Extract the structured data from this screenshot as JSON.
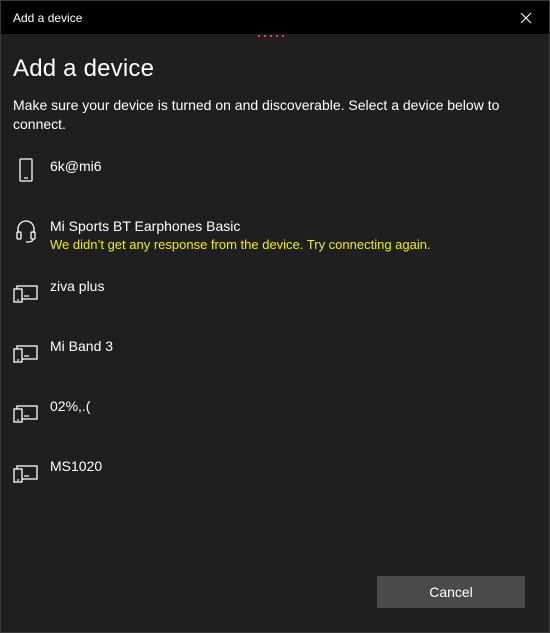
{
  "window": {
    "title": "Add a device"
  },
  "dialog": {
    "heading": "Add a device",
    "instructions": "Make sure your device is turned on and discoverable. Select a device below to connect."
  },
  "devices": [
    {
      "name": "6k@mi6",
      "icon": "phone-icon",
      "status": ""
    },
    {
      "name": "Mi Sports BT Earphones Basic",
      "icon": "headset-icon",
      "status": "We didn’t get any response from the device. Try connecting again."
    },
    {
      "name": "ziva plus",
      "icon": "devices-icon",
      "status": ""
    },
    {
      "name": "Mi Band 3",
      "icon": "devices-icon",
      "status": ""
    },
    {
      "name": "02%,.(",
      "icon": "devices-icon",
      "status": ""
    },
    {
      "name": "MS1020",
      "icon": "devices-icon",
      "status": ""
    }
  ],
  "buttons": {
    "cancel": "Cancel"
  },
  "colors": {
    "accent_progress": "#e0405a",
    "warning_text": "#f1e81d",
    "titlebar": "#000000",
    "background": "#1f1f1f"
  }
}
